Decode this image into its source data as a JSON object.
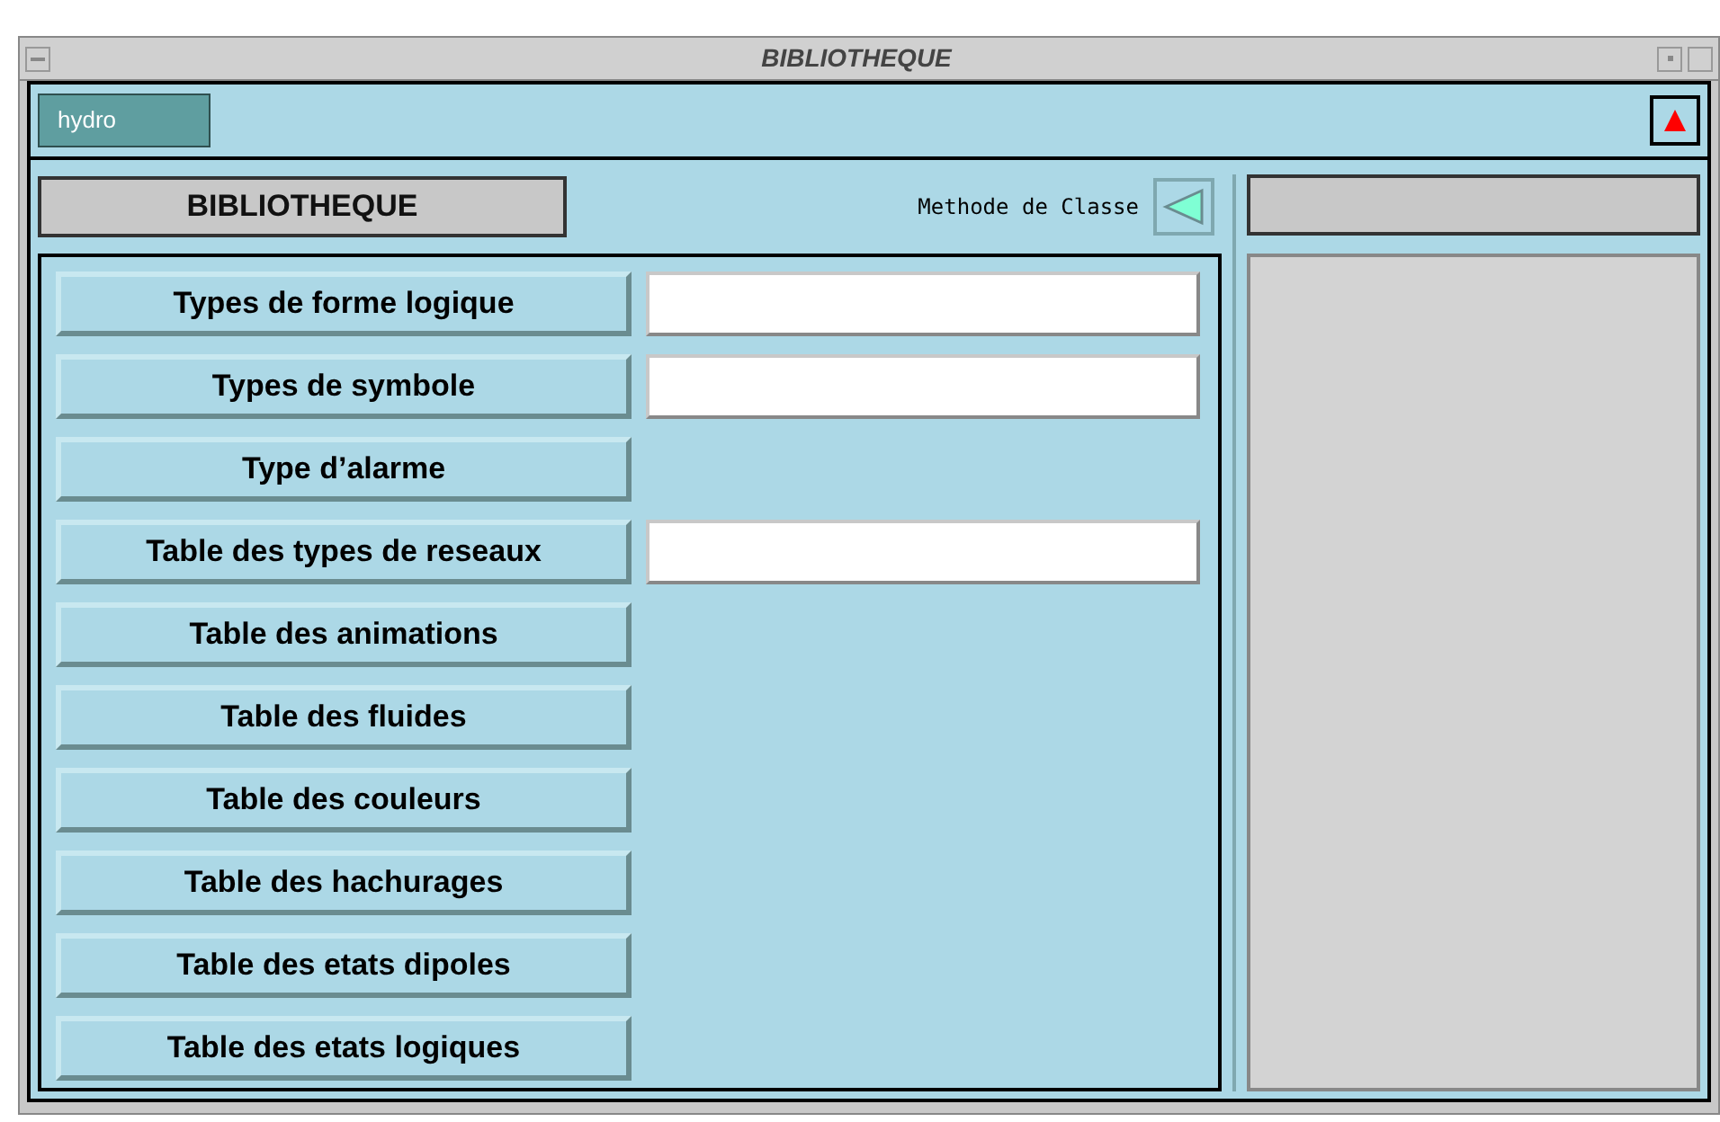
{
  "window": {
    "title": "BIBLIOTHEQUE"
  },
  "toolbar": {
    "user_button": "hydro"
  },
  "panel": {
    "title": "BIBLIOTHEQUE",
    "method_label": "Methode de Classe"
  },
  "items": [
    {
      "label": "Types de forme logique",
      "kind": "with-field"
    },
    {
      "label": "Types de symbole",
      "kind": "with-field"
    },
    {
      "label": "Type d’alarme",
      "kind": "plain"
    },
    {
      "label": "Table des types de reseaux",
      "kind": "with-field"
    },
    {
      "label": "Table des animations",
      "kind": "plain"
    },
    {
      "label": "Table des fluides",
      "kind": "plain"
    },
    {
      "label": "Table des couleurs",
      "kind": "plain"
    },
    {
      "label": "Table des hachurages",
      "kind": "plain"
    },
    {
      "label": "Table des etats dipoles",
      "kind": "plain"
    },
    {
      "label": "Table des etats logiques",
      "kind": "plain"
    }
  ]
}
